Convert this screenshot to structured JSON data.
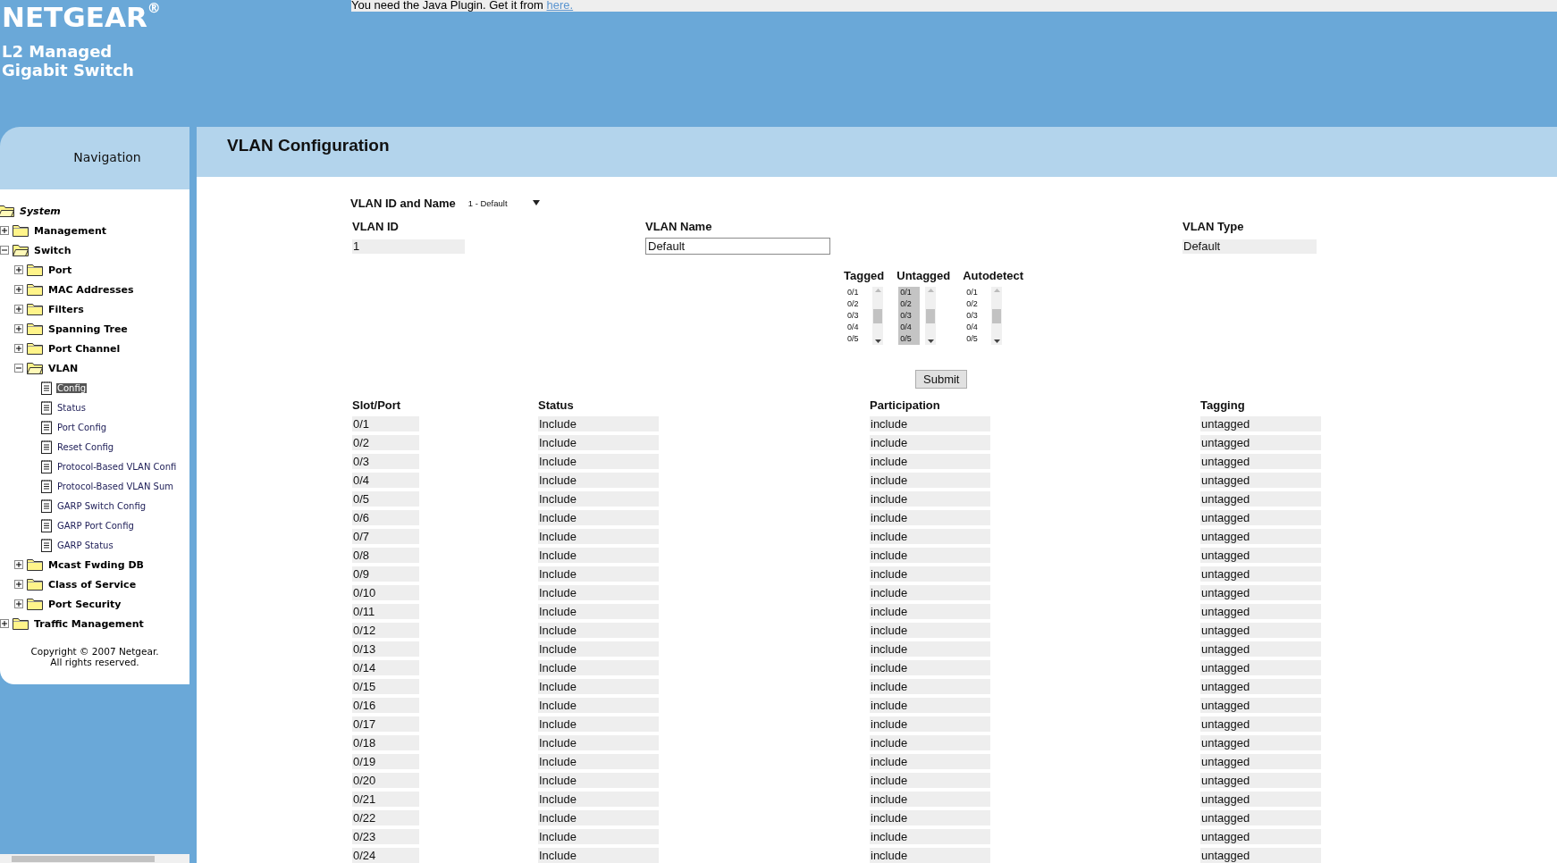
{
  "header": {
    "logo": "NETGEAR",
    "logo_mark": "®",
    "subtitle_lines": [
      "L2 Managed",
      "Gigabit Switch"
    ],
    "java_notice": {
      "text": "You need the Java Plugin. Get it from ",
      "link": "here."
    }
  },
  "navigation": {
    "title": "Navigation",
    "tree": [
      {
        "label": "System",
        "kind": "folder",
        "expanded": true,
        "selected": false,
        "children": [
          {
            "label": "Management",
            "kind": "folder",
            "expanded": false,
            "selected": false
          },
          {
            "label": "Switch",
            "kind": "folder",
            "expanded": true,
            "selected": false,
            "children": [
              {
                "label": "Port",
                "kind": "folder",
                "expanded": false,
                "selected": false
              },
              {
                "label": "MAC Addresses",
                "kind": "folder",
                "expanded": false,
                "selected": false
              },
              {
                "label": "Filters",
                "kind": "folder",
                "expanded": false,
                "selected": false
              },
              {
                "label": "Spanning Tree",
                "kind": "folder",
                "expanded": false,
                "selected": false
              },
              {
                "label": "Port Channel",
                "kind": "folder",
                "expanded": false,
                "selected": false
              },
              {
                "label": "VLAN",
                "kind": "folder",
                "expanded": true,
                "selected": false,
                "children": [
                  {
                    "label": "Config",
                    "kind": "page",
                    "selected": true
                  },
                  {
                    "label": "Status",
                    "kind": "page",
                    "selected": false
                  },
                  {
                    "label": "Port Config",
                    "kind": "page",
                    "selected": false
                  },
                  {
                    "label": "Reset Config",
                    "kind": "page",
                    "selected": false
                  },
                  {
                    "label": "Protocol-Based VLAN Confi",
                    "kind": "page",
                    "selected": false
                  },
                  {
                    "label": "Protocol-Based VLAN Sum",
                    "kind": "page",
                    "selected": false
                  },
                  {
                    "label": "GARP Switch Config",
                    "kind": "page",
                    "selected": false
                  },
                  {
                    "label": "GARP Port Config",
                    "kind": "page",
                    "selected": false
                  },
                  {
                    "label": "GARP Status",
                    "kind": "page",
                    "selected": false
                  }
                ]
              },
              {
                "label": "Mcast Fwding DB",
                "kind": "folder",
                "expanded": false,
                "selected": false
              },
              {
                "label": "Class of Service",
                "kind": "folder",
                "expanded": false,
                "selected": false
              },
              {
                "label": "Port Security",
                "kind": "folder",
                "expanded": false,
                "selected": false
              }
            ]
          },
          {
            "label": "Traffic Management",
            "kind": "folder",
            "expanded": false,
            "selected": false
          }
        ]
      }
    ],
    "copyright_lines": [
      "Copyright © 2007 Netgear.",
      "All rights reserved."
    ]
  },
  "page": {
    "title": "VLAN Configuration",
    "vlan_select": {
      "label": "VLAN ID and Name",
      "value": "1 - Default"
    },
    "fields": [
      {
        "label": "VLAN ID",
        "value": "1",
        "kind": "readonly"
      },
      {
        "label": "VLAN Name",
        "value": "Default",
        "kind": "input"
      },
      {
        "label": "VLAN Type",
        "value": "Default",
        "kind": "readonly"
      }
    ],
    "port_lists": [
      {
        "label": "Tagged",
        "items": [
          {
            "label": "0/1",
            "selected": false
          },
          {
            "label": "0/2",
            "selected": false
          },
          {
            "label": "0/3",
            "selected": false
          },
          {
            "label": "0/4",
            "selected": false
          },
          {
            "label": "0/5",
            "selected": false
          }
        ]
      },
      {
        "label": "Untagged",
        "items": [
          {
            "label": "0/1",
            "selected": true
          },
          {
            "label": "0/2",
            "selected": true
          },
          {
            "label": "0/3",
            "selected": true
          },
          {
            "label": "0/4",
            "selected": true
          },
          {
            "label": "0/5",
            "selected": true
          }
        ]
      },
      {
        "label": "Autodetect",
        "items": [
          {
            "label": "0/1",
            "selected": false
          },
          {
            "label": "0/2",
            "selected": false
          },
          {
            "label": "0/3",
            "selected": false
          },
          {
            "label": "0/4",
            "selected": false
          },
          {
            "label": "0/5",
            "selected": false
          }
        ]
      }
    ],
    "submit": "Submit",
    "table": {
      "columns": [
        "Slot/Port",
        "Status",
        "Participation",
        "Tagging"
      ],
      "rows": [
        [
          "0/1",
          "Include",
          "include",
          "untagged"
        ],
        [
          "0/2",
          "Include",
          "include",
          "untagged"
        ],
        [
          "0/3",
          "Include",
          "include",
          "untagged"
        ],
        [
          "0/4",
          "Include",
          "include",
          "untagged"
        ],
        [
          "0/5",
          "Include",
          "include",
          "untagged"
        ],
        [
          "0/6",
          "Include",
          "include",
          "untagged"
        ],
        [
          "0/7",
          "Include",
          "include",
          "untagged"
        ],
        [
          "0/8",
          "Include",
          "include",
          "untagged"
        ],
        [
          "0/9",
          "Include",
          "include",
          "untagged"
        ],
        [
          "0/10",
          "Include",
          "include",
          "untagged"
        ],
        [
          "0/11",
          "Include",
          "include",
          "untagged"
        ],
        [
          "0/12",
          "Include",
          "include",
          "untagged"
        ],
        [
          "0/13",
          "Include",
          "include",
          "untagged"
        ],
        [
          "0/14",
          "Include",
          "include",
          "untagged"
        ],
        [
          "0/15",
          "Include",
          "include",
          "untagged"
        ],
        [
          "0/16",
          "Include",
          "include",
          "untagged"
        ],
        [
          "0/17",
          "Include",
          "include",
          "untagged"
        ],
        [
          "0/18",
          "Include",
          "include",
          "untagged"
        ],
        [
          "0/19",
          "Include",
          "include",
          "untagged"
        ],
        [
          "0/20",
          "Include",
          "include",
          "untagged"
        ],
        [
          "0/21",
          "Include",
          "include",
          "untagged"
        ],
        [
          "0/22",
          "Include",
          "include",
          "untagged"
        ],
        [
          "0/23",
          "Include",
          "include",
          "untagged"
        ],
        [
          "0/24",
          "Include",
          "include",
          "untagged"
        ]
      ]
    }
  }
}
